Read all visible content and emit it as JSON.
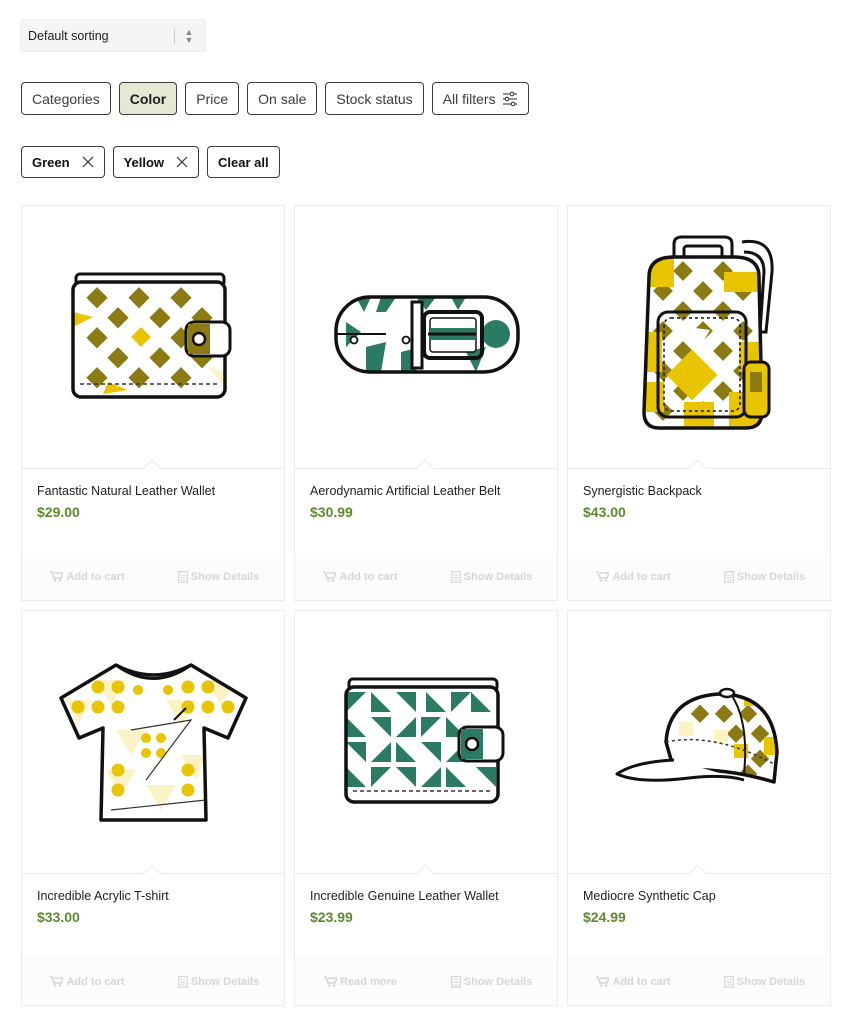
{
  "sorting": {
    "selected": "Default sorting"
  },
  "filters": [
    "Categories",
    "Color",
    "Price",
    "On sale",
    "Stock status",
    "All filters"
  ],
  "active_filter_index": 1,
  "active_filters": [
    "Green",
    "Yellow"
  ],
  "clear_all_label": "Clear all",
  "colors": {
    "price": "#5c8a2c",
    "active_chip": "#e4e9d6",
    "yellow": "#e9c400",
    "olive": "#8c7a12",
    "green": "#2b7a63"
  },
  "products": [
    {
      "name": "Fantastic Natural Leather Wallet",
      "price": "$29.00",
      "action": "Add to cart",
      "details": "Show Details",
      "icon": "wallet-yellow-icon"
    },
    {
      "name": "Aerodynamic Artificial Leather Belt",
      "price": "$30.99",
      "action": "Add to cart",
      "details": "Show Details",
      "icon": "belt-icon"
    },
    {
      "name": "Synergistic Backpack",
      "price": "$43.00",
      "action": "Add to cart",
      "details": "Show Details",
      "icon": "backpack-icon"
    },
    {
      "name": "Incredible Acrylic T-shirt",
      "price": "$33.00",
      "action": "Add to cart",
      "details": "Show Details",
      "icon": "tshirt-icon"
    },
    {
      "name": "Incredible Genuine Leather Wallet",
      "price": "$23.99",
      "action": "Read more",
      "details": "Show Details",
      "icon": "wallet-green-icon"
    },
    {
      "name": "Mediocre Synthetic Cap",
      "price": "$24.99",
      "action": "Add to cart",
      "details": "Show Details",
      "icon": "cap-icon"
    }
  ]
}
